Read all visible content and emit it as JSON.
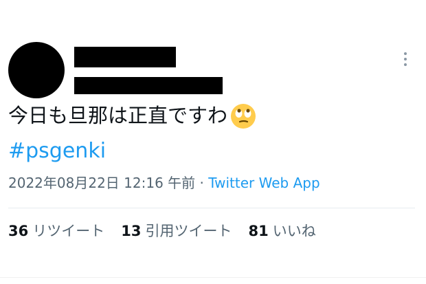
{
  "tweet": {
    "text": "今日も旦那は正直ですわ",
    "emoji_icon": "face-with-rolling-eyes-icon",
    "hashtag": "#psgenki",
    "timestamp": "2022年08月22日 12:16 午前",
    "separator": " · ",
    "source": "Twitter Web App"
  },
  "stats": {
    "retweets_count": "36",
    "retweets_label": "リツイート",
    "quotes_count": "13",
    "quotes_label": "引用ツイート",
    "likes_count": "81",
    "likes_label": "いいね"
  },
  "colors": {
    "link": "#1d9bf0",
    "muted": "#536471",
    "text": "#0f1419",
    "redaction": "#000000"
  }
}
